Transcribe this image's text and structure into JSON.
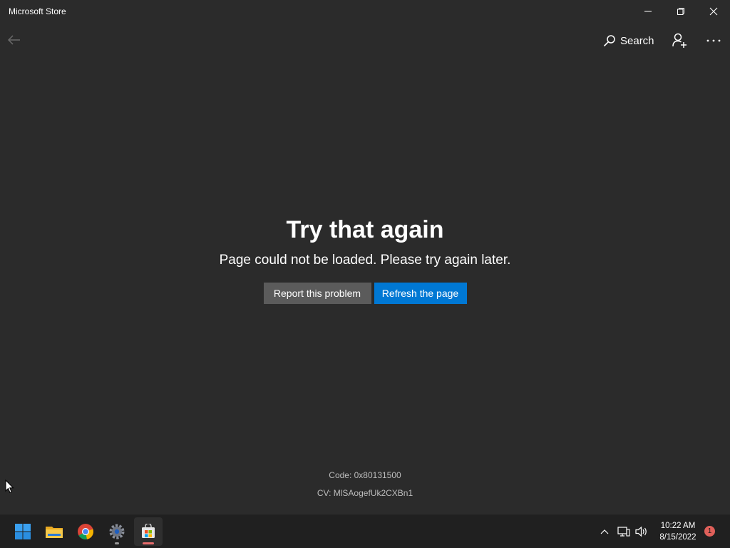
{
  "window": {
    "title": "Microsoft Store",
    "controls": [
      "minimize-icon",
      "restore-icon",
      "close-icon"
    ]
  },
  "nav": {
    "back_icon": "back-arrow-icon",
    "search_label": "Search",
    "search_icon": "search-icon",
    "account_icon": "add-account-icon",
    "more_icon": "more-icon"
  },
  "error": {
    "title": "Try that again",
    "message": "Page could not be loaded. Please try again later.",
    "report_button": "Report this problem",
    "refresh_button": "Refresh the page",
    "code": "Code: 0x80131500",
    "cv": "CV: MlSAogefUk2CXBn1"
  },
  "taskbar": {
    "apps": [
      "windows-start-icon",
      "file-explorer-icon",
      "chrome-icon",
      "settings-icon",
      "microsoft-store-icon"
    ],
    "active_app": "microsoft-store-icon",
    "time": "10:22 AM",
    "date": "8/15/2022",
    "notification_count": "1"
  },
  "colors": {
    "background": "#2b2b2b",
    "accent": "#0078d4",
    "secondary_button": "#5b5b5b",
    "taskbar": "#202020",
    "badge": "#e0605a"
  }
}
